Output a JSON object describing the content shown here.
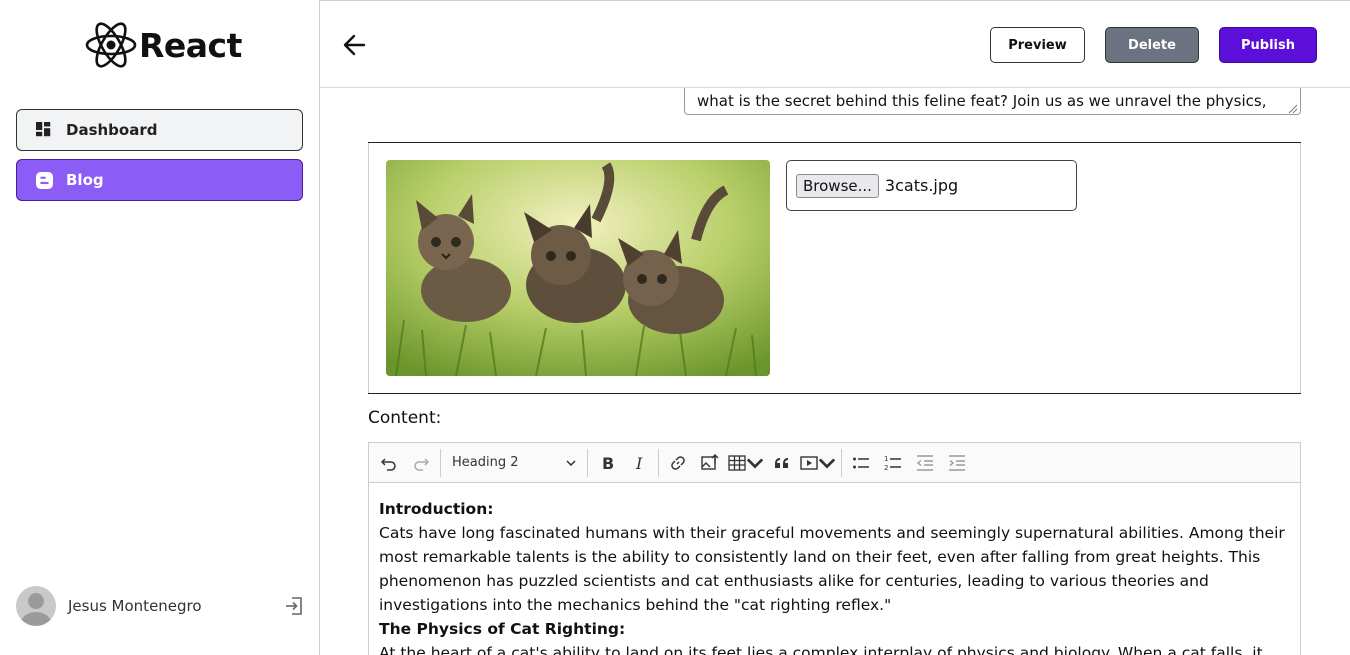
{
  "brand": {
    "name": "React",
    "accent": "#61dafb"
  },
  "sidebar": {
    "items": [
      {
        "label": "Dashboard",
        "icon": "dashboard-grid-icon",
        "active": false
      },
      {
        "label": "Blog",
        "icon": "blogger-icon",
        "active": true
      }
    ],
    "user": {
      "name": "Jesus Montenegro"
    }
  },
  "header": {
    "preview_label": "Preview",
    "delete_label": "Delete",
    "publish_label": "Publish"
  },
  "colors": {
    "active_nav": "#8b5cf6",
    "publish": "#5b0fd9",
    "delete": "#6b7280"
  },
  "summary": {
    "visible_text": "what is the secret behind this feline feat? Join us as we unravel the physics,"
  },
  "image_upload": {
    "browse_label": "Browse...",
    "file_name": "3cats.jpg"
  },
  "content": {
    "label": "Content:",
    "toolbar": {
      "heading_value": "Heading 2"
    },
    "paragraphs": [
      {
        "heading": "Introduction:"
      },
      {
        "text": "Cats have long fascinated humans with their graceful movements and seemingly supernatural abilities. Among their most remarkable talents is the ability to consistently land on their feet, even after falling from great heights. This phenomenon has puzzled scientists and cat enthusiasts alike for centuries, leading to various theories and investigations into the mechanics behind the \"cat righting reflex.\""
      },
      {
        "heading": "The Physics of Cat Righting:"
      },
      {
        "text": "At the heart of a cat's ability to land on its feet lies a complex interplay of physics and biology. When a cat falls, it"
      }
    ]
  }
}
